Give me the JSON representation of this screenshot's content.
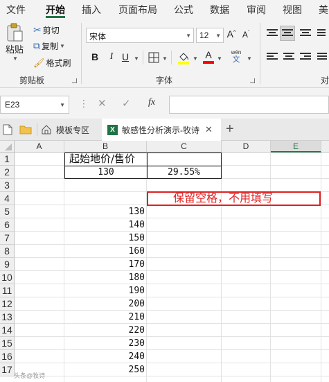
{
  "menu": {
    "tabs": [
      "文件",
      "开始",
      "插入",
      "页面布局",
      "公式",
      "数据",
      "审阅",
      "视图",
      "美"
    ],
    "active": "开始"
  },
  "ribbon": {
    "clipboard": {
      "paste_label": "粘贴",
      "cut_label": "剪切",
      "copy_label": "复制",
      "format_painter_label": "格式刷",
      "group_label": "剪贴板"
    },
    "font": {
      "font_name": "宋体",
      "font_size": "12",
      "grow_label": "A",
      "shrink_label": "A",
      "bold_label": "B",
      "italic_label": "I",
      "underline_label": "U",
      "fill_color": "#ffff00",
      "font_color": "#ff0000",
      "font_color_label": "A",
      "phonetic_top": "wén",
      "phonetic_bottom": "文",
      "group_label": "字体"
    },
    "alignment": {
      "group_label": "对"
    }
  },
  "formula_bar": {
    "name_box": "E23",
    "fx_label": "fx",
    "formula": ""
  },
  "tabs": {
    "template_tab": "模板专区",
    "file_tab": "敏感性分析演示-牧诗"
  },
  "sheet": {
    "columns": [
      "A",
      "B",
      "C",
      "D",
      "E"
    ],
    "selected_column": "E",
    "rows": [
      "1",
      "2",
      "3",
      "4",
      "5",
      "6",
      "7",
      "8",
      "9",
      "10",
      "11",
      "12",
      "13",
      "14",
      "15",
      "16",
      "17"
    ],
    "header_cell": "起始地价/售价",
    "b2": "130",
    "c2": "29.55%",
    "annotation": "保留空格，不用填写",
    "b_values": [
      "130",
      "140",
      "150",
      "160",
      "170",
      "180",
      "190",
      "200",
      "210",
      "220",
      "230",
      "240",
      "250"
    ],
    "watermark": "头条@牧诗"
  },
  "colors": {
    "accent": "#217346",
    "annotation": "#e02020"
  }
}
